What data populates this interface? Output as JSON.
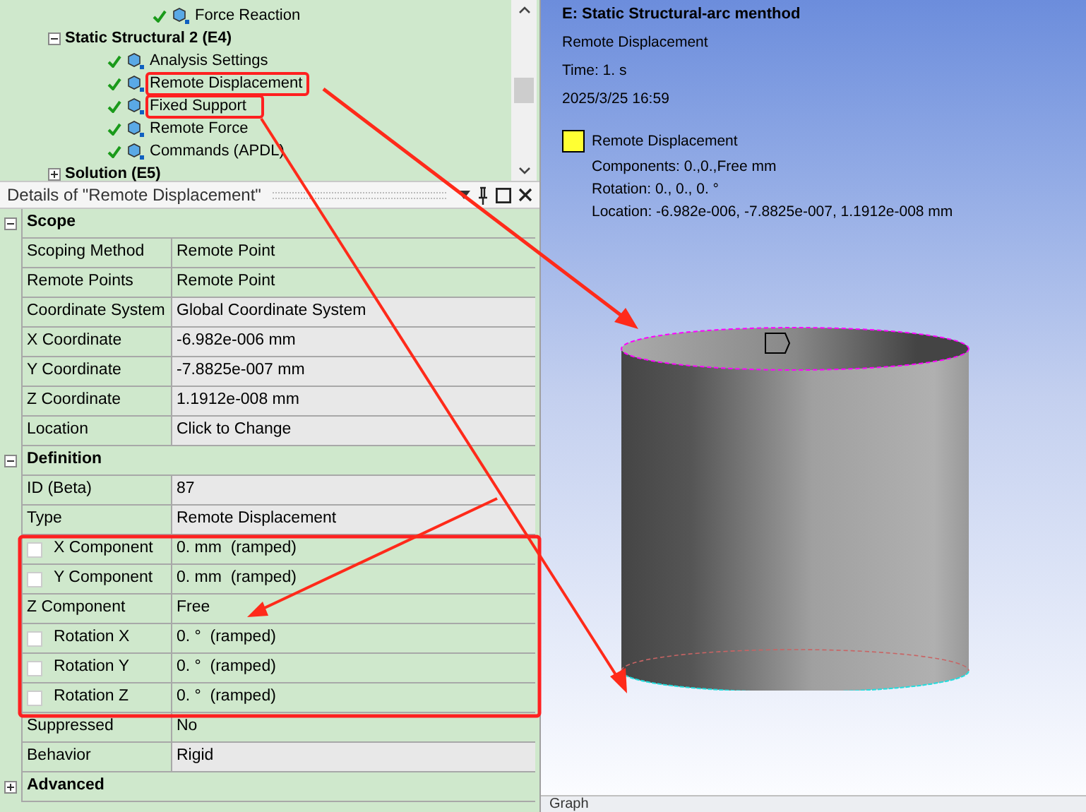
{
  "tree": {
    "above": {
      "label": "Force Reaction",
      "checked": true
    },
    "items": [
      {
        "label": "Static Structural 2 (E4)",
        "expanded": true,
        "children": [
          {
            "label": "Analysis Settings",
            "checked": true
          },
          {
            "label": "Remote Displacement",
            "checked": true
          },
          {
            "label": "Fixed Support",
            "checked": true
          },
          {
            "label": "Remote Force",
            "checked": true
          },
          {
            "label": "Commands (APDL)",
            "checked": true
          }
        ]
      },
      {
        "label": "Solution (E5)",
        "expanded": false
      }
    ]
  },
  "details": {
    "title": "Details of \"Remote Displacement\"",
    "sections": [
      {
        "label": "Scope",
        "expanded": true,
        "rows": [
          {
            "kind": "plain",
            "name": "Scoping Method",
            "value": "Remote Point",
            "read_only": false
          },
          {
            "kind": "plain",
            "name": "Remote Points",
            "value": "Remote Point",
            "read_only": false
          },
          {
            "kind": "plain",
            "name": "Coordinate System",
            "value": "Global Coordinate System",
            "read_only": true
          },
          {
            "kind": "plain",
            "name": "X Coordinate",
            "value": "-6.982e-006 mm",
            "read_only": true
          },
          {
            "kind": "plain",
            "name": "Y Coordinate",
            "value": "-7.8825e-007 mm",
            "read_only": true
          },
          {
            "kind": "plain",
            "name": "Z Coordinate",
            "value": "1.1912e-008 mm",
            "read_only": true
          },
          {
            "kind": "plain",
            "name": "Location",
            "value": "Click to Change",
            "read_only": true
          }
        ]
      },
      {
        "label": "Definition",
        "expanded": true,
        "rows": [
          {
            "kind": "plain",
            "name": "ID (Beta)",
            "value": "87",
            "read_only": true
          },
          {
            "kind": "plain",
            "name": "Type",
            "value": "Remote Displacement",
            "read_only": true
          },
          {
            "kind": "checkbox",
            "checked": false,
            "name": "X Component",
            "value": "0. mm  (ramped)",
            "read_only": false
          },
          {
            "kind": "checkbox",
            "checked": false,
            "name": "Y Component",
            "value": "0. mm  (ramped)",
            "read_only": false
          },
          {
            "kind": "plain",
            "name": "Z Component",
            "value": "Free",
            "read_only": false
          },
          {
            "kind": "checkbox",
            "checked": false,
            "name": "Rotation X",
            "value": "0. °  (ramped)",
            "read_only": false
          },
          {
            "kind": "checkbox",
            "checked": false,
            "name": "Rotation Y",
            "value": "0. °  (ramped)",
            "read_only": false
          },
          {
            "kind": "checkbox",
            "checked": false,
            "name": "Rotation Z",
            "value": "0. °  (ramped)",
            "read_only": false
          },
          {
            "kind": "plain",
            "name": "Suppressed",
            "value": "No",
            "read_only": false
          },
          {
            "kind": "plain",
            "name": "Behavior",
            "value": "Rigid",
            "read_only": true
          }
        ]
      },
      {
        "label": "Advanced",
        "expanded": false
      }
    ]
  },
  "viewport": {
    "title": "E: Static Structural-arc menthod",
    "lines": [
      "Remote Displacement",
      "Time: 1. s",
      "2025/3/25 16:59"
    ],
    "legend": {
      "color": "#ffff33",
      "label": "Remote Displacement",
      "lines": [
        "Components: 0.,0.,Free mm",
        "Rotation: 0., 0., 0. °",
        "Location: -6.982e-006, -7.8825e-007, 1.1912e-008 mm"
      ]
    }
  },
  "bottom_tab": {
    "label": "Graph"
  }
}
